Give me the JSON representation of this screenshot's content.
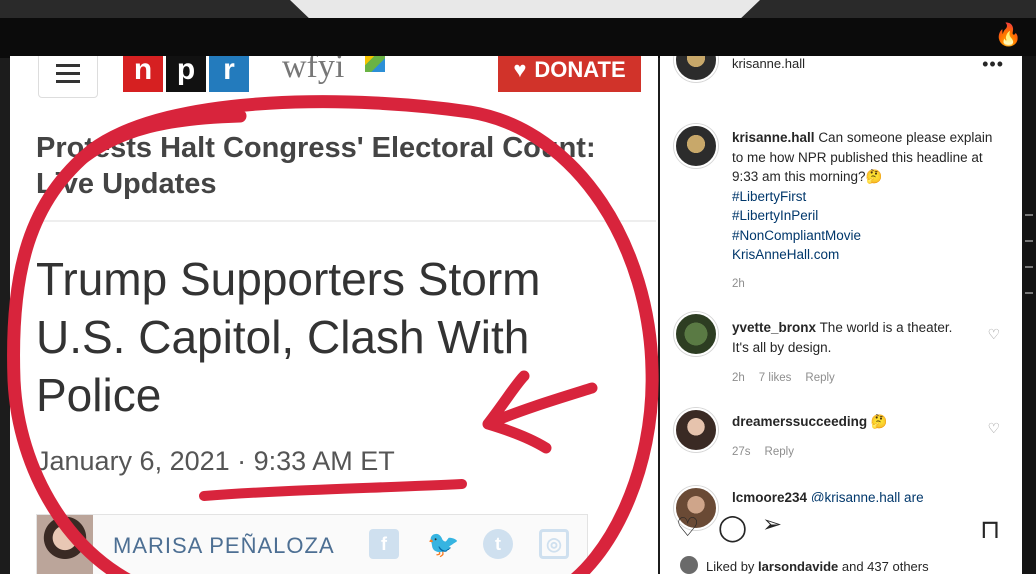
{
  "npr": {
    "logo_letters": [
      "n",
      "p",
      "r"
    ],
    "station": "wfyi",
    "donate_label": "DONATE",
    "subhead": "Protests Halt Congress' Electoral Count: Live Updates",
    "headline": "Trump Supporters Storm U.S. Capitol, Clash With Police",
    "date": "January 6, 2021",
    "separator": " · ",
    "time": "9:33 AM ET",
    "author": "MARISA PEÑALOZA",
    "social_icons": [
      "facebook-icon",
      "twitter-icon",
      "tumblr-icon",
      "instagram-icon"
    ],
    "colors": {
      "npr_red": "#d62021",
      "npr_black": "#111111",
      "npr_blue": "#237bbd",
      "donate": "#d1332a",
      "annotation": "#d8243c"
    }
  },
  "instagram": {
    "post_user": "krisanne.hall",
    "more_label": "•••",
    "caption": {
      "user": "krisanne.hall",
      "text": "Can someone please explain to me how NPR published this headline at 9:33 am this morning?🤔",
      "hashtags": [
        "#LibertyFirst",
        "#LibertyInPeril",
        "#NonCompliantMovie"
      ],
      "link": "KrisAnneHall.com",
      "age": "2h"
    },
    "comments": [
      {
        "user": "yvette_bronx",
        "text": "The world is a theater. It's all by design.",
        "age": "2h",
        "likes": "7 likes",
        "reply": "Reply"
      },
      {
        "user": "dreamerssucceeding",
        "text": "🤔",
        "age": "27s",
        "reply": "Reply"
      },
      {
        "user": "lcmoore234",
        "text": "@krisanne.hall are"
      }
    ],
    "liked_by": {
      "prefix": "Liked by",
      "user": "larsondavide",
      "suffix": "and 437 others"
    }
  }
}
